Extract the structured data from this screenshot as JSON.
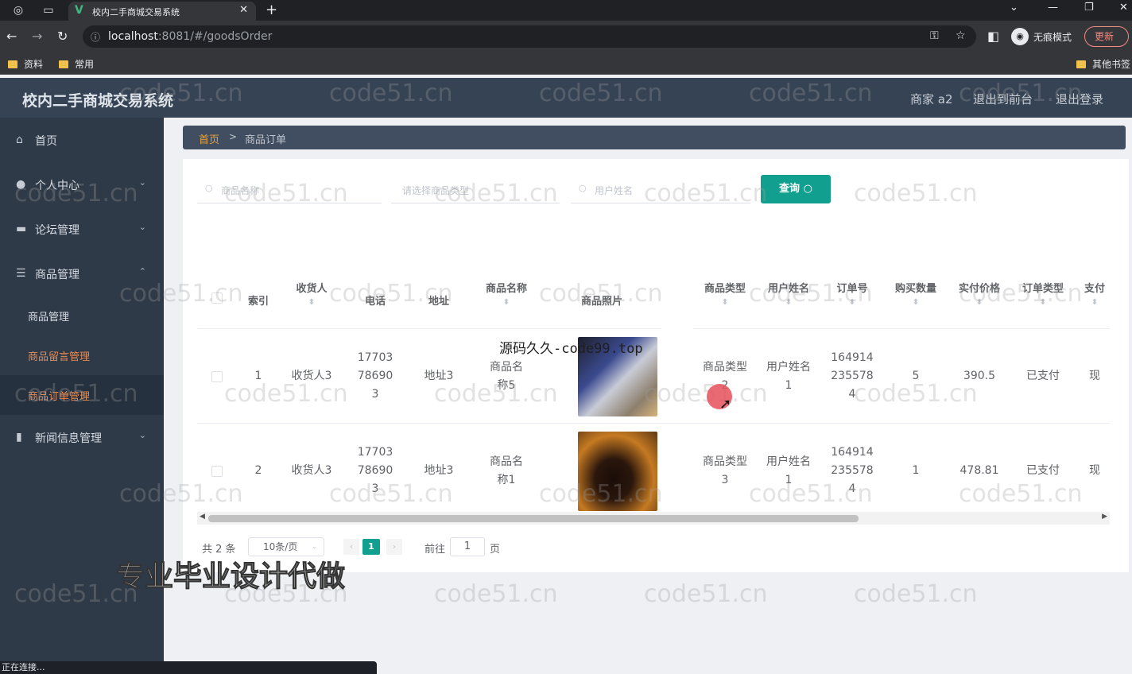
{
  "browser": {
    "tab_title": "校内二手商城交易系统",
    "url_host": "localhost",
    "url_rest": ":8081/#/goodsOrder",
    "incognito_label": "无痕模式",
    "update_label": "更新",
    "bookmarks": [
      "资料",
      "常用"
    ],
    "other_bookmarks": "其他书签",
    "status_text": "正在连接..."
  },
  "header": {
    "title": "校内二手商城交易系统",
    "user": "商家 a2",
    "back_front": "退出到前台",
    "logout": "退出登录"
  },
  "sidebar": {
    "home": "首页",
    "personal": "个人中心",
    "forum": "论坛管理",
    "goods": "商品管理",
    "goods_sub": [
      "商品管理",
      "商品留言管理",
      "商品订单管理"
    ],
    "news": "新闻信息管理"
  },
  "breadcrumb": {
    "home": "首页",
    "current": "商品订单"
  },
  "search": {
    "goods_name_placeholder": "商品名称",
    "goods_type_placeholder": "请选择商品类型",
    "user_name_placeholder": "用户姓名",
    "query_label": "查询"
  },
  "table": {
    "headers": {
      "index": "索引",
      "receiver": "收货人",
      "phone": "电话",
      "address": "地址",
      "goods_name": "商品名称",
      "goods_photo": "商品照片",
      "goods_type": "商品类型",
      "user_name": "用户姓名",
      "order_no": "订单号",
      "quantity": "购买数量",
      "price": "实付价格",
      "order_type": "订单类型",
      "pay": "支付"
    },
    "rows": [
      {
        "index": "1",
        "receiver": "收货人3",
        "phone": "17703786903",
        "address": "地址3",
        "goods_name": "商品名称5",
        "goods_type": "商品类型2",
        "user_name": "用户姓名1",
        "order_no": "1649142355784",
        "quantity": "5",
        "price": "390.5",
        "order_type": "已支付",
        "pay": "现"
      },
      {
        "index": "2",
        "receiver": "收货人3",
        "phone": "17703786903",
        "address": "地址3",
        "goods_name": "商品名称1",
        "goods_type": "商品类型3",
        "user_name": "用户姓名1",
        "order_no": "1649142355784",
        "quantity": "1",
        "price": "478.81",
        "order_type": "已支付",
        "pay": "现"
      }
    ]
  },
  "pagination": {
    "total": "共 2 条",
    "page_size": "10条/页",
    "current": "1",
    "goto": "前往",
    "goto_value": "1",
    "page": "页"
  },
  "overlays": {
    "watermark": "code51.cn",
    "top_banner": "源码久久-code99.top",
    "big_banner": "专业毕业设计代做"
  }
}
